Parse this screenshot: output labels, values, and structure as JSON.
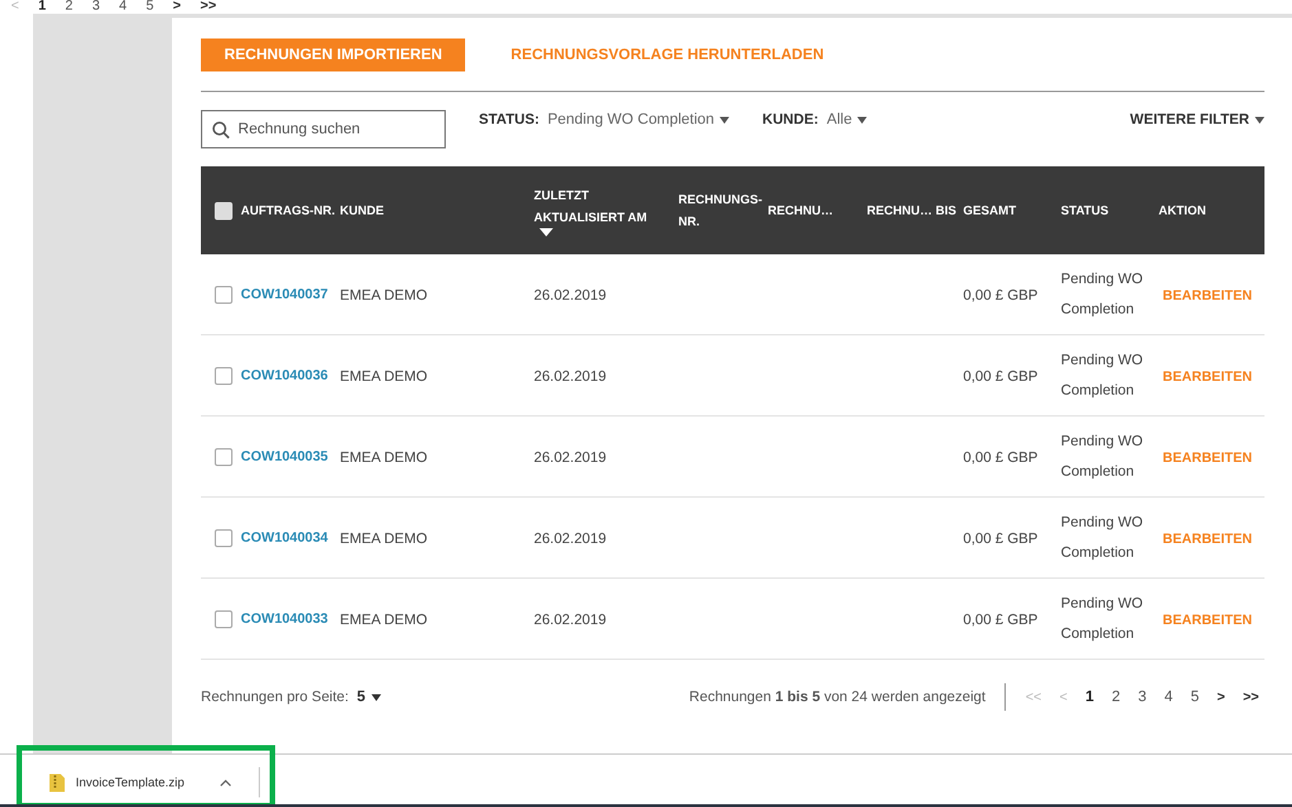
{
  "top_pager": [
    {
      "label": "<",
      "kind": "nav",
      "disabled": true,
      "selected": false
    },
    {
      "label": "1",
      "kind": "page",
      "disabled": false,
      "selected": true
    },
    {
      "label": "2",
      "kind": "page",
      "disabled": false,
      "selected": false
    },
    {
      "label": "3",
      "kind": "page",
      "disabled": false,
      "selected": false
    },
    {
      "label": "4",
      "kind": "page",
      "disabled": false,
      "selected": false
    },
    {
      "label": "5",
      "kind": "page",
      "disabled": false,
      "selected": false
    },
    {
      "label": ">",
      "kind": "nav",
      "disabled": false,
      "selected": false
    },
    {
      "label": ">>",
      "kind": "nav",
      "disabled": false,
      "selected": false
    }
  ],
  "tabs": [
    {
      "label": "RECHNUNGEN IMPORTIEREN",
      "selected": true
    },
    {
      "label": "RECHNUNGSVORLAGE HERUNTERLADEN",
      "selected": false
    }
  ],
  "search": {
    "placeholder": "Rechnung suchen"
  },
  "filters": [
    {
      "label": "STATUS:",
      "value": "Pending WO Completion"
    },
    {
      "label": "KUNDE:",
      "value": "Alle"
    }
  ],
  "more_filters": "WEITERE FILTER",
  "table": {
    "select_all_checked": false,
    "columns": [
      {
        "label": "AUFTRAGS-NR."
      },
      {
        "label": "KUNDE"
      },
      {
        "label": "ZULETZT AKTUALISIERT AM",
        "sorted": true
      },
      {
        "label": "RECHNUNGS-NR."
      },
      {
        "label": "RECHNU…"
      },
      {
        "label": "RECHNU… BIS"
      },
      {
        "label": "GESAMT"
      },
      {
        "label": "STATUS"
      },
      {
        "label": "AKTION"
      }
    ],
    "rows": [
      {
        "checked": false,
        "order": "COW1040037",
        "customer": "EMEA DEMO",
        "updated": "26.02.2019",
        "total": "0,00 £ GBP",
        "status": "Pending WO Completion",
        "action": "BEARBEITEN"
      },
      {
        "checked": false,
        "order": "COW1040036",
        "customer": "EMEA DEMO",
        "updated": "26.02.2019",
        "total": "0,00 £ GBP",
        "status": "Pending WO Completion",
        "action": "BEARBEITEN"
      },
      {
        "checked": false,
        "order": "COW1040035",
        "customer": "EMEA DEMO",
        "updated": "26.02.2019",
        "total": "0,00 £ GBP",
        "status": "Pending WO Completion",
        "action": "BEARBEITEN"
      },
      {
        "checked": false,
        "order": "COW1040034",
        "customer": "EMEA DEMO",
        "updated": "26.02.2019",
        "total": "0,00 £ GBP",
        "status": "Pending WO Completion",
        "action": "BEARBEITEN"
      },
      {
        "checked": false,
        "order": "COW1040033",
        "customer": "EMEA DEMO",
        "updated": "26.02.2019",
        "total": "0,00 £ GBP",
        "status": "Pending WO Completion",
        "action": "BEARBEITEN"
      }
    ]
  },
  "footer": {
    "per_page_label": "Rechnungen pro Seite:",
    "per_page": "5",
    "summary": "Rechnungen **1 bis 5** von 24 werden angezeigt",
    "pager": [
      {
        "label": "<<",
        "kind": "nav",
        "disabled": true,
        "selected": false
      },
      {
        "label": "<",
        "kind": "nav",
        "disabled": true,
        "selected": false
      },
      {
        "label": "1",
        "kind": "page",
        "disabled": false,
        "selected": true
      },
      {
        "label": "2",
        "kind": "page",
        "disabled": false,
        "selected": false
      },
      {
        "label": "3",
        "kind": "page",
        "disabled": false,
        "selected": false
      },
      {
        "label": "4",
        "kind": "page",
        "disabled": false,
        "selected": false
      },
      {
        "label": "5",
        "kind": "page",
        "disabled": false,
        "selected": false
      },
      {
        "label": ">",
        "kind": "nav",
        "disabled": false,
        "selected": false
      },
      {
        "label": ">>",
        "kind": "nav",
        "disabled": false,
        "selected": false
      }
    ]
  },
  "download": {
    "file": "InvoiceTemplate.zip",
    "highlighted": true
  }
}
